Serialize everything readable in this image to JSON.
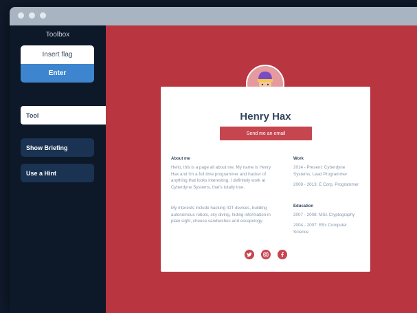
{
  "sidebar": {
    "title": "Toolbox",
    "flag_label": "Insert flag",
    "enter_label": "Enter",
    "tool_tab": "Tool",
    "show_briefing": "Show Briefing",
    "use_hint": "Use a Hint"
  },
  "profile": {
    "name": "Henry Hax",
    "email_button": "Send me an email",
    "about_heading": "About me",
    "about_p1": "Hello, this is a page all about me. My name is Henry Hax and I'm a full time programmer and hacker of anything that looks interesting. I definitely work at Cyberdyne Systems, that's totally true.",
    "about_p2": "My interests include hacking IOT devices, building autonomous robots, sky diving, hiding information in plain sight, cheese sandwiches and escapology.",
    "work_heading": "Work",
    "work_1": "2014 - Present: Cyberdyne Systems, Lead Programmer",
    "work_2": "2008 - 2013: E Corp, Programmer",
    "edu_heading": "Education",
    "edu_1": "2007 - 2008: MSc Cryptography",
    "edu_2": "2004 - 2007: BSc Computer Science"
  },
  "social_icons": [
    "twitter-icon",
    "instagram-icon",
    "facebook-icon"
  ],
  "colors": {
    "content_bg": "#b93540",
    "accent": "#c5464f",
    "enter_button": "#3d86cf",
    "side_button": "#1a3352"
  }
}
